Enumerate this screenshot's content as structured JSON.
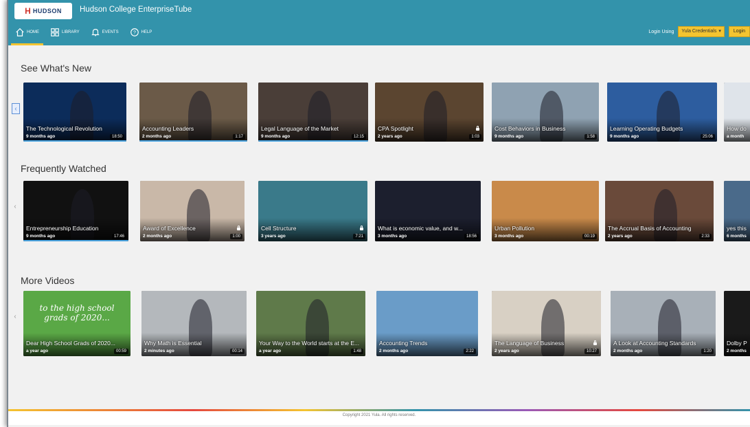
{
  "header": {
    "logo_text": "HUDSON",
    "title": "Hudson College EnterpriseTube",
    "nav": [
      {
        "label": "Home",
        "icon": "home-icon",
        "active": true
      },
      {
        "label": "Library",
        "icon": "grid-icon",
        "active": false
      },
      {
        "label": "Events",
        "icon": "bell-icon",
        "active": false
      },
      {
        "label": "Help",
        "icon": "help-icon",
        "active": false
      }
    ],
    "login_label": "Login Using",
    "login_select": "Yula Credentials",
    "login_button": "Login"
  },
  "sections": [
    {
      "title": "See What's New",
      "videos": [
        {
          "title": "The Technological Revolution",
          "age": "9 months ago",
          "duration": "18:50",
          "bg": "#0c2c5a"
        },
        {
          "title": "Accounting Leaders",
          "age": "2 months ago",
          "duration": "1:17",
          "bg": "#6b5a48"
        },
        {
          "title": "Legal Language of the Market",
          "age": "9 months ago",
          "duration": "12:15",
          "bg": "#4a3e38"
        },
        {
          "title": "CPA Spotlight",
          "age": "2 years ago",
          "duration": "1:03",
          "bg": "#5b4530"
        },
        {
          "title": "Cost Behaviors in Business",
          "age": "9 months ago",
          "duration": "1:58",
          "bg": "#8fa2b2"
        },
        {
          "title": "Learning Operating Budgets",
          "age": "9 months ago",
          "duration": "25:06",
          "bg": "#2d5d9f"
        },
        {
          "title": "How do",
          "age": "a month",
          "duration": "",
          "bg": "#dfe4ea"
        }
      ]
    },
    {
      "title": "Frequently Watched",
      "videos": [
        {
          "title": "Entrepreneurship Education",
          "age": "9 months ago",
          "duration": "17:46",
          "bg": "#111111"
        },
        {
          "title": "Award of Excellence",
          "age": "2 months ago",
          "duration": "1:00",
          "bg": "#c9b8a8"
        },
        {
          "title": "Cell Structure",
          "age": "3 years ago",
          "duration": "7:21",
          "bg": "#3a7a8a"
        },
        {
          "title": "What is economic value, and w...",
          "age": "3 months ago",
          "duration": "18:56",
          "bg": "#1c1f2e"
        },
        {
          "title": "Urban Pollution",
          "age": "3 months ago",
          "duration": "00:19",
          "bg": "#c98a4a"
        },
        {
          "title": "The Accrual Basis of Accounting",
          "age": "2 years ago",
          "duration": "2:33",
          "bg": "#6a4a3a"
        },
        {
          "title": "yes this",
          "age": "6 months",
          "duration": "",
          "bg": "#4a6a8a"
        }
      ]
    },
    {
      "title": "More Videos",
      "videos": [
        {
          "title": "Dear High School Grads of 2020...",
          "age": "a year ago",
          "duration": "00:59",
          "bg": "#5aa846",
          "overlay": "to the high school grads of 2020..."
        },
        {
          "title": "Why Math is Essential",
          "age": "2 minutes ago",
          "duration": "00:14",
          "bg": "#b4b8bc"
        },
        {
          "title": "Your Way to the World starts at the E...",
          "age": "a year ago",
          "duration": "1:48",
          "bg": "#5f7a4a"
        },
        {
          "title": "Accounting Trends",
          "age": "2 months ago",
          "duration": "2:22",
          "bg": "#6a9cc8"
        },
        {
          "title": "The Language of Business",
          "age": "2 years ago",
          "duration": "10:27",
          "bg": "#d8d0c4"
        },
        {
          "title": "A Look at Accounting Standards",
          "age": "2 months ago",
          "duration": "1:20",
          "bg": "#a8b0b8"
        },
        {
          "title": "Dolby P",
          "age": "2 months",
          "duration": "",
          "bg": "#1a1a1a"
        }
      ]
    }
  ],
  "footer": {
    "copyright": "Copyright 2021 Yula. All rights reserved."
  }
}
